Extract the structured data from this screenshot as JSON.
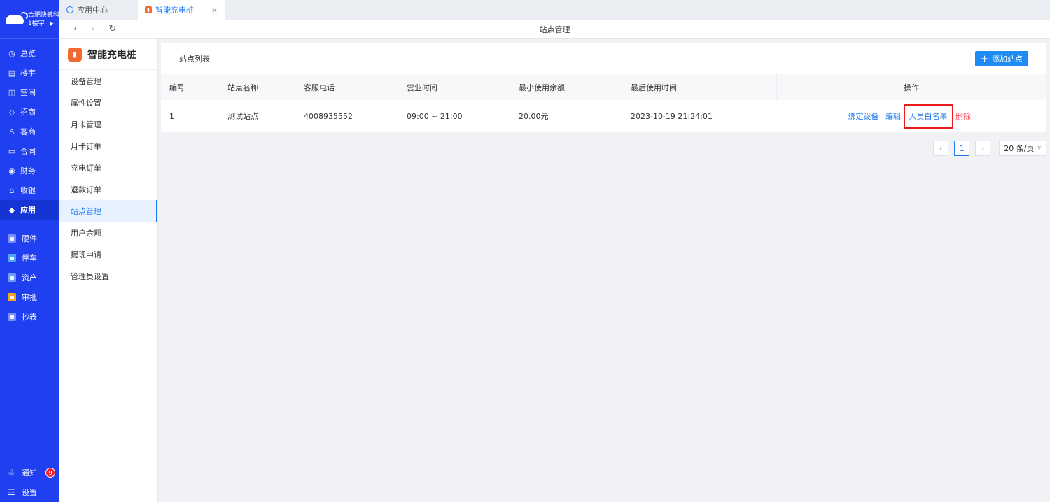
{
  "org": {
    "name": "合肥快鲸科",
    "building": "1楼宇"
  },
  "nav": {
    "items": [
      {
        "label": "总览",
        "icon": "dashboard-icon"
      },
      {
        "label": "楼宇",
        "icon": "building-icon"
      },
      {
        "label": "空间",
        "icon": "cube-icon"
      },
      {
        "label": "招商",
        "icon": "tag-icon"
      },
      {
        "label": "客商",
        "icon": "users-icon"
      },
      {
        "label": "合同",
        "icon": "document-icon"
      },
      {
        "label": "财务",
        "icon": "coin-icon"
      },
      {
        "label": "收银",
        "icon": "home-icon"
      },
      {
        "label": "应用",
        "icon": "apps-icon"
      }
    ],
    "apps": [
      {
        "label": "硬件",
        "color": "#7b8cff"
      },
      {
        "label": "停车",
        "color": "#4fa3ff"
      },
      {
        "label": "资产",
        "color": "#6e9bff"
      },
      {
        "label": "审批",
        "color": "#f5a623"
      },
      {
        "label": "抄表",
        "color": "#7b8cff"
      }
    ],
    "notice": {
      "label": "通知",
      "count": "9"
    },
    "settings": {
      "label": "设置"
    }
  },
  "tabs": [
    {
      "label": "应用中心"
    },
    {
      "label": "智能充电桩"
    }
  ],
  "address": {
    "title": "站点管理"
  },
  "subnav": {
    "app_name": "智能充电桩",
    "items": [
      "设备管理",
      "属性设置",
      "月卡管理",
      "月卡订单",
      "充电订单",
      "退款订单",
      "站点管理",
      "用户余额",
      "提现申请",
      "管理员设置"
    ]
  },
  "panel": {
    "title": "站点列表",
    "add_label": "添加站点"
  },
  "table": {
    "headers": [
      "编号",
      "站点名称",
      "客服电话",
      "营业时间",
      "最小使用余额",
      "最后使用时间",
      "操作"
    ],
    "rows": [
      {
        "id": "1",
        "name": "测试站点",
        "phone": "4008935552",
        "hours": "09:00 ~ 21:00",
        "min_balance": "20.00元",
        "last_used": "2023-10-19 21:24:01",
        "actions": [
          "绑定设备",
          "编辑",
          "人员白名单",
          "删除"
        ]
      }
    ]
  },
  "pagination": {
    "current": "1",
    "page_size": "20 条/页"
  },
  "colors": {
    "sidebar": "#1f3ff0",
    "accent": "#1f7cf5",
    "danger": "#f5475a",
    "highlight_box": "#e81c1c"
  }
}
